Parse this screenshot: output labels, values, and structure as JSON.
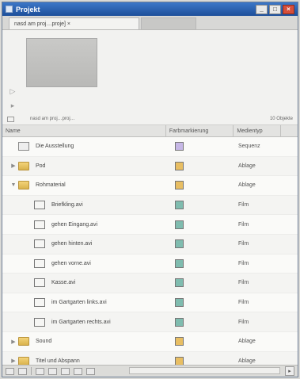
{
  "window": {
    "title": "Projekt",
    "controls": {
      "min": "_",
      "max": "□",
      "close": "×"
    }
  },
  "tabs": [
    {
      "label": "nasd am proj…proje] ×",
      "active": true
    },
    {
      "label": "",
      "active": false
    }
  ],
  "preview": {
    "selection_text": "nasd am proj…proj…",
    "count_text": "10 Objekte"
  },
  "columns": {
    "name": "Name",
    "label": "Farbmarkierung",
    "type": "Medientyp"
  },
  "rows": [
    {
      "name": "Die Ausstellung",
      "type": "Sequenz",
      "icon": "sequence-icon",
      "indent": 0,
      "twisty": "",
      "label_color": "#c6b7e6"
    },
    {
      "name": "Pod",
      "type": "Ablage",
      "icon": "folder-icon",
      "indent": 0,
      "twisty": "▶",
      "label_color": "#e8be63"
    },
    {
      "name": "Rohmaterial",
      "type": "Ablage",
      "icon": "folder-icon",
      "indent": 0,
      "twisty": "▼",
      "label_color": "#e8be63"
    },
    {
      "name": "Briefkling.avi",
      "type": "Film",
      "icon": "film-icon",
      "indent": 1,
      "twisty": "",
      "label_color": "#7fbcaf"
    },
    {
      "name": "gehen Eingang.avi",
      "type": "Film",
      "icon": "film-icon",
      "indent": 1,
      "twisty": "",
      "label_color": "#7fbcaf"
    },
    {
      "name": "gehen hinten.avi",
      "type": "Film",
      "icon": "film-icon",
      "indent": 1,
      "twisty": "",
      "label_color": "#7fbcaf"
    },
    {
      "name": "gehen vorne.avi",
      "type": "Film",
      "icon": "film-icon",
      "indent": 1,
      "twisty": "",
      "label_color": "#7fbcaf"
    },
    {
      "name": "Kasse.avi",
      "type": "Film",
      "icon": "film-icon",
      "indent": 1,
      "twisty": "",
      "label_color": "#7fbcaf"
    },
    {
      "name": "im Gartgarten links.avi",
      "type": "Film",
      "icon": "film-icon",
      "indent": 1,
      "twisty": "",
      "label_color": "#7fbcaf"
    },
    {
      "name": "im Gartgarten rechts.avi",
      "type": "Film",
      "icon": "film-icon",
      "indent": 1,
      "twisty": "",
      "label_color": "#7fbcaf"
    },
    {
      "name": "Sound",
      "type": "Ablage",
      "icon": "folder-icon",
      "indent": 0,
      "twisty": "▶",
      "label_color": "#e8be63"
    },
    {
      "name": "Titel und Abspann",
      "type": "Ablage",
      "icon": "folder-icon",
      "indent": 0,
      "twisty": "▶",
      "label_color": "#e8be63"
    }
  ]
}
